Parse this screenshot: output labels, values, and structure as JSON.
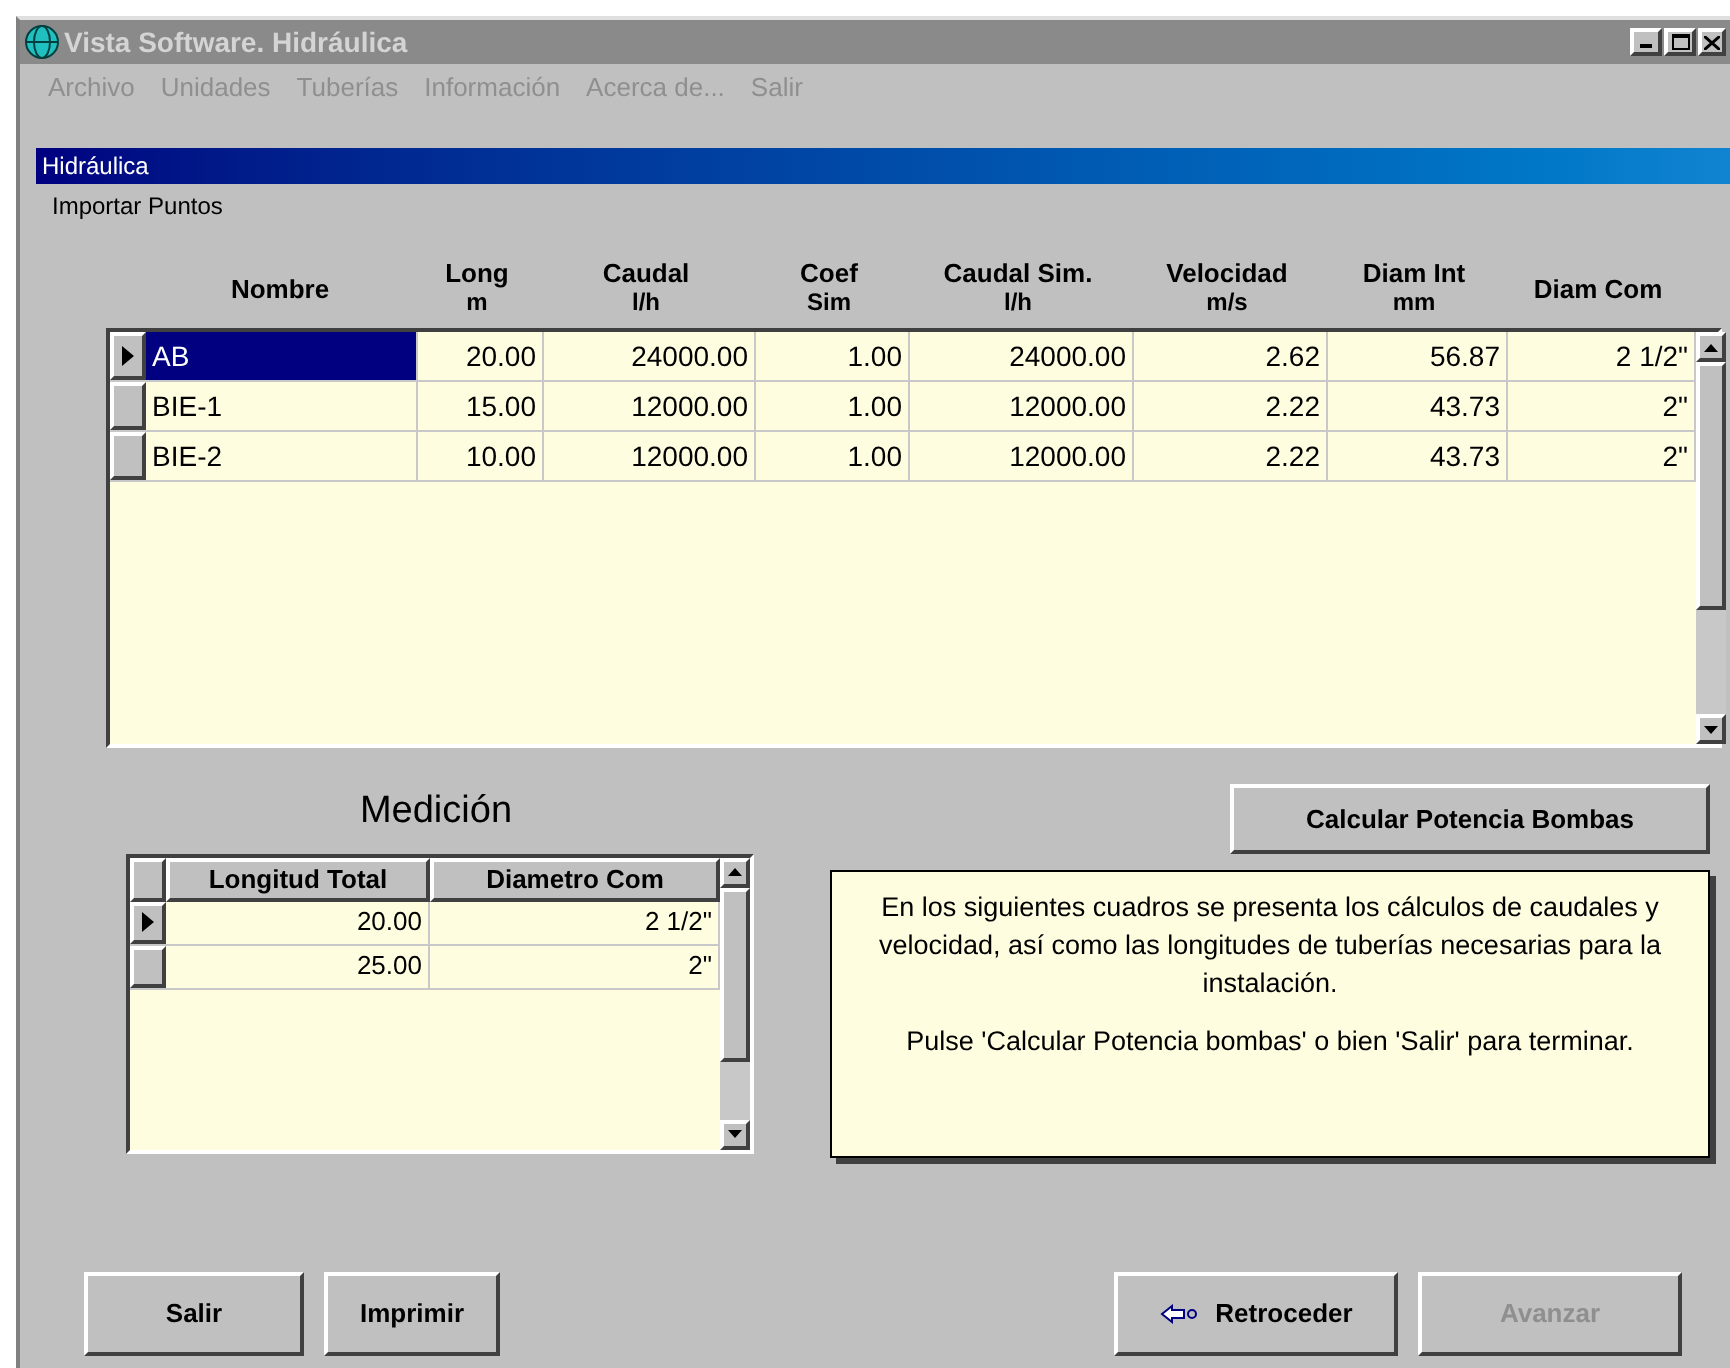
{
  "window": {
    "title": "Vista Software. Hidráulica",
    "active": false
  },
  "menu": [
    {
      "label": "Archivo",
      "disabled": true
    },
    {
      "label": "Unidades",
      "disabled": true
    },
    {
      "label": "Tuberías",
      "disabled": true
    },
    {
      "label": "Información",
      "disabled": true
    },
    {
      "label": "Acerca de...",
      "disabled": true
    },
    {
      "label": "Salir",
      "disabled": true
    }
  ],
  "subwindow": {
    "title": "Hidráulica",
    "menu": "Importar Puntos"
  },
  "table": {
    "columns": [
      {
        "name": "Nombre"
      },
      {
        "name": "Long",
        "unit": "m"
      },
      {
        "name": "Caudal",
        "unit": "l/h"
      },
      {
        "name": "Coef",
        "unit": "Sim"
      },
      {
        "name": "Caudal Sim.",
        "unit": "l/h"
      },
      {
        "name": "Velocidad",
        "unit": "m/s"
      },
      {
        "name": "Diam Int",
        "unit": "mm"
      },
      {
        "name": "Diam Com"
      }
    ],
    "rows": [
      {
        "selected": true,
        "cells": [
          "AB",
          "20.00",
          "24000.00",
          "1.00",
          "24000.00",
          "2.62",
          "56.87",
          "2 1/2\""
        ]
      },
      {
        "selected": false,
        "cells": [
          "BIE-1",
          "15.00",
          "12000.00",
          "1.00",
          "12000.00",
          "2.22",
          "43.73",
          "2\""
        ]
      },
      {
        "selected": false,
        "cells": [
          "BIE-2",
          "10.00",
          "12000.00",
          "1.00",
          "12000.00",
          "2.22",
          "43.73",
          "2\""
        ]
      }
    ]
  },
  "medicion": {
    "title": "Medición",
    "columns": [
      "Longitud Total",
      "Diametro Com"
    ],
    "rows": [
      {
        "selected": true,
        "cells": [
          "20.00",
          "2 1/2\""
        ]
      },
      {
        "selected": false,
        "cells": [
          "25.00",
          "2\""
        ]
      }
    ]
  },
  "calc_button": {
    "label": "Calcular Potencia Bombas"
  },
  "note": [
    "En los siguientes cuadros se presenta los cálculos de caudales y velocidad, así como las longitudes de tuberías necesarias para la instalación.",
    "Pulse 'Calcular Potencia bombas' o bien 'Salir' para terminar."
  ],
  "buttons": [
    {
      "label": "Salir",
      "kind": "plain",
      "disabled": false
    },
    {
      "label": "Imprimir",
      "kind": "plain",
      "disabled": false
    },
    {
      "label": "Retroceder",
      "kind": "back",
      "disabled": false
    },
    {
      "label": "Avanzar",
      "kind": "plain",
      "disabled": true
    }
  ]
}
